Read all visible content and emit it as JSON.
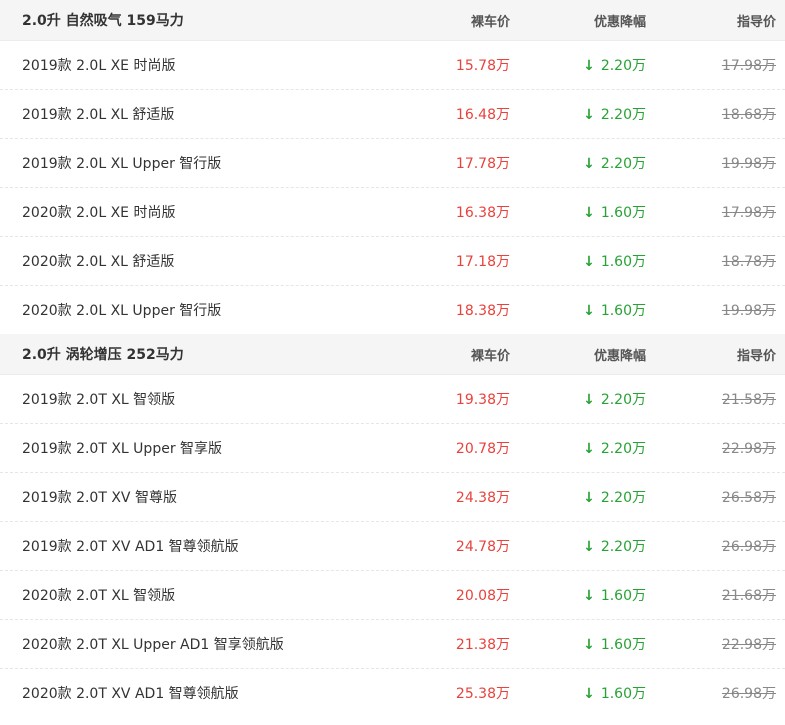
{
  "sections": [
    {
      "title": "2.0升 自然吸气 159马力",
      "col_price": "裸车价",
      "col_discount": "优惠降幅",
      "col_guide": "指导价",
      "rows": [
        {
          "name": "2019款 2.0L XE 时尚版",
          "price": "15.78万",
          "discount": "2.20万",
          "guide": "17.98万"
        },
        {
          "name": "2019款 2.0L XL 舒适版",
          "price": "16.48万",
          "discount": "2.20万",
          "guide": "18.68万"
        },
        {
          "name": "2019款 2.0L XL Upper 智行版",
          "price": "17.78万",
          "discount": "2.20万",
          "guide": "19.98万"
        },
        {
          "name": "2020款 2.0L XE 时尚版",
          "price": "16.38万",
          "discount": "1.60万",
          "guide": "17.98万"
        },
        {
          "name": "2020款 2.0L XL 舒适版",
          "price": "17.18万",
          "discount": "1.60万",
          "guide": "18.78万"
        },
        {
          "name": "2020款 2.0L XL Upper 智行版",
          "price": "18.38万",
          "discount": "1.60万",
          "guide": "19.98万"
        }
      ]
    },
    {
      "title": "2.0升 涡轮增压 252马力",
      "col_price": "裸车价",
      "col_discount": "优惠降幅",
      "col_guide": "指导价",
      "rows": [
        {
          "name": "2019款 2.0T XL 智领版",
          "price": "19.38万",
          "discount": "2.20万",
          "guide": "21.58万"
        },
        {
          "name": "2019款 2.0T XL Upper 智享版",
          "price": "20.78万",
          "discount": "2.20万",
          "guide": "22.98万"
        },
        {
          "name": "2019款 2.0T XV 智尊版",
          "price": "24.38万",
          "discount": "2.20万",
          "guide": "26.58万"
        },
        {
          "name": "2019款 2.0T XV AD1 智尊领航版",
          "price": "24.78万",
          "discount": "2.20万",
          "guide": "26.98万"
        },
        {
          "name": "2020款 2.0T XL 智领版",
          "price": "20.08万",
          "discount": "1.60万",
          "guide": "21.68万"
        },
        {
          "name": "2020款 2.0T XL Upper AD1 智享领航版",
          "price": "21.38万",
          "discount": "1.60万",
          "guide": "22.98万"
        },
        {
          "name": "2020款 2.0T XV AD1 智尊领航版",
          "price": "25.38万",
          "discount": "1.60万",
          "guide": "26.98万"
        }
      ]
    }
  ],
  "icons": {
    "discount_arrow": "down-arrow-icon",
    "arrow_glyph": "↓"
  },
  "colors": {
    "price": "#e8423c",
    "discount": "#27a234",
    "guide": "#888888",
    "header_bg": "#f5f5f5"
  }
}
